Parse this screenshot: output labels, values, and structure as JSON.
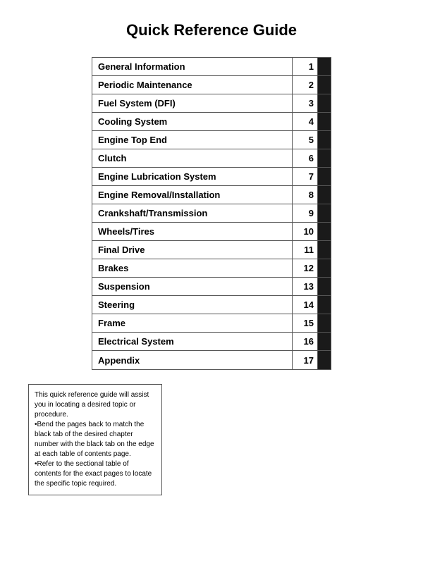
{
  "title": "Quick Reference Guide",
  "entries": [
    {
      "label": "General Information",
      "number": "1"
    },
    {
      "label": "Periodic Maintenance",
      "number": "2"
    },
    {
      "label": "Fuel System (DFI)",
      "number": "3"
    },
    {
      "label": "Cooling System",
      "number": "4"
    },
    {
      "label": "Engine Top End",
      "number": "5"
    },
    {
      "label": "Clutch",
      "number": "6"
    },
    {
      "label": "Engine Lubrication System",
      "number": "7"
    },
    {
      "label": "Engine Removal/Installation",
      "number": "8"
    },
    {
      "label": "Crankshaft/Transmission",
      "number": "9"
    },
    {
      "label": "Wheels/Tires",
      "number": "10"
    },
    {
      "label": "Final Drive",
      "number": "11"
    },
    {
      "label": "Brakes",
      "number": "12"
    },
    {
      "label": "Suspension",
      "number": "13"
    },
    {
      "label": "Steering",
      "number": "14"
    },
    {
      "label": "Frame",
      "number": "15"
    },
    {
      "label": "Electrical System",
      "number": "16"
    },
    {
      "label": "Appendix",
      "number": "17"
    }
  ],
  "note": "This quick reference guide will assist you in locating a desired topic or procedure.\n•Bend the pages back to match the black tab of the desired chapter number with the black tab on the edge at each table of contents page.\n•Refer to the sectional table of contents for the exact pages to locate the specific topic required."
}
